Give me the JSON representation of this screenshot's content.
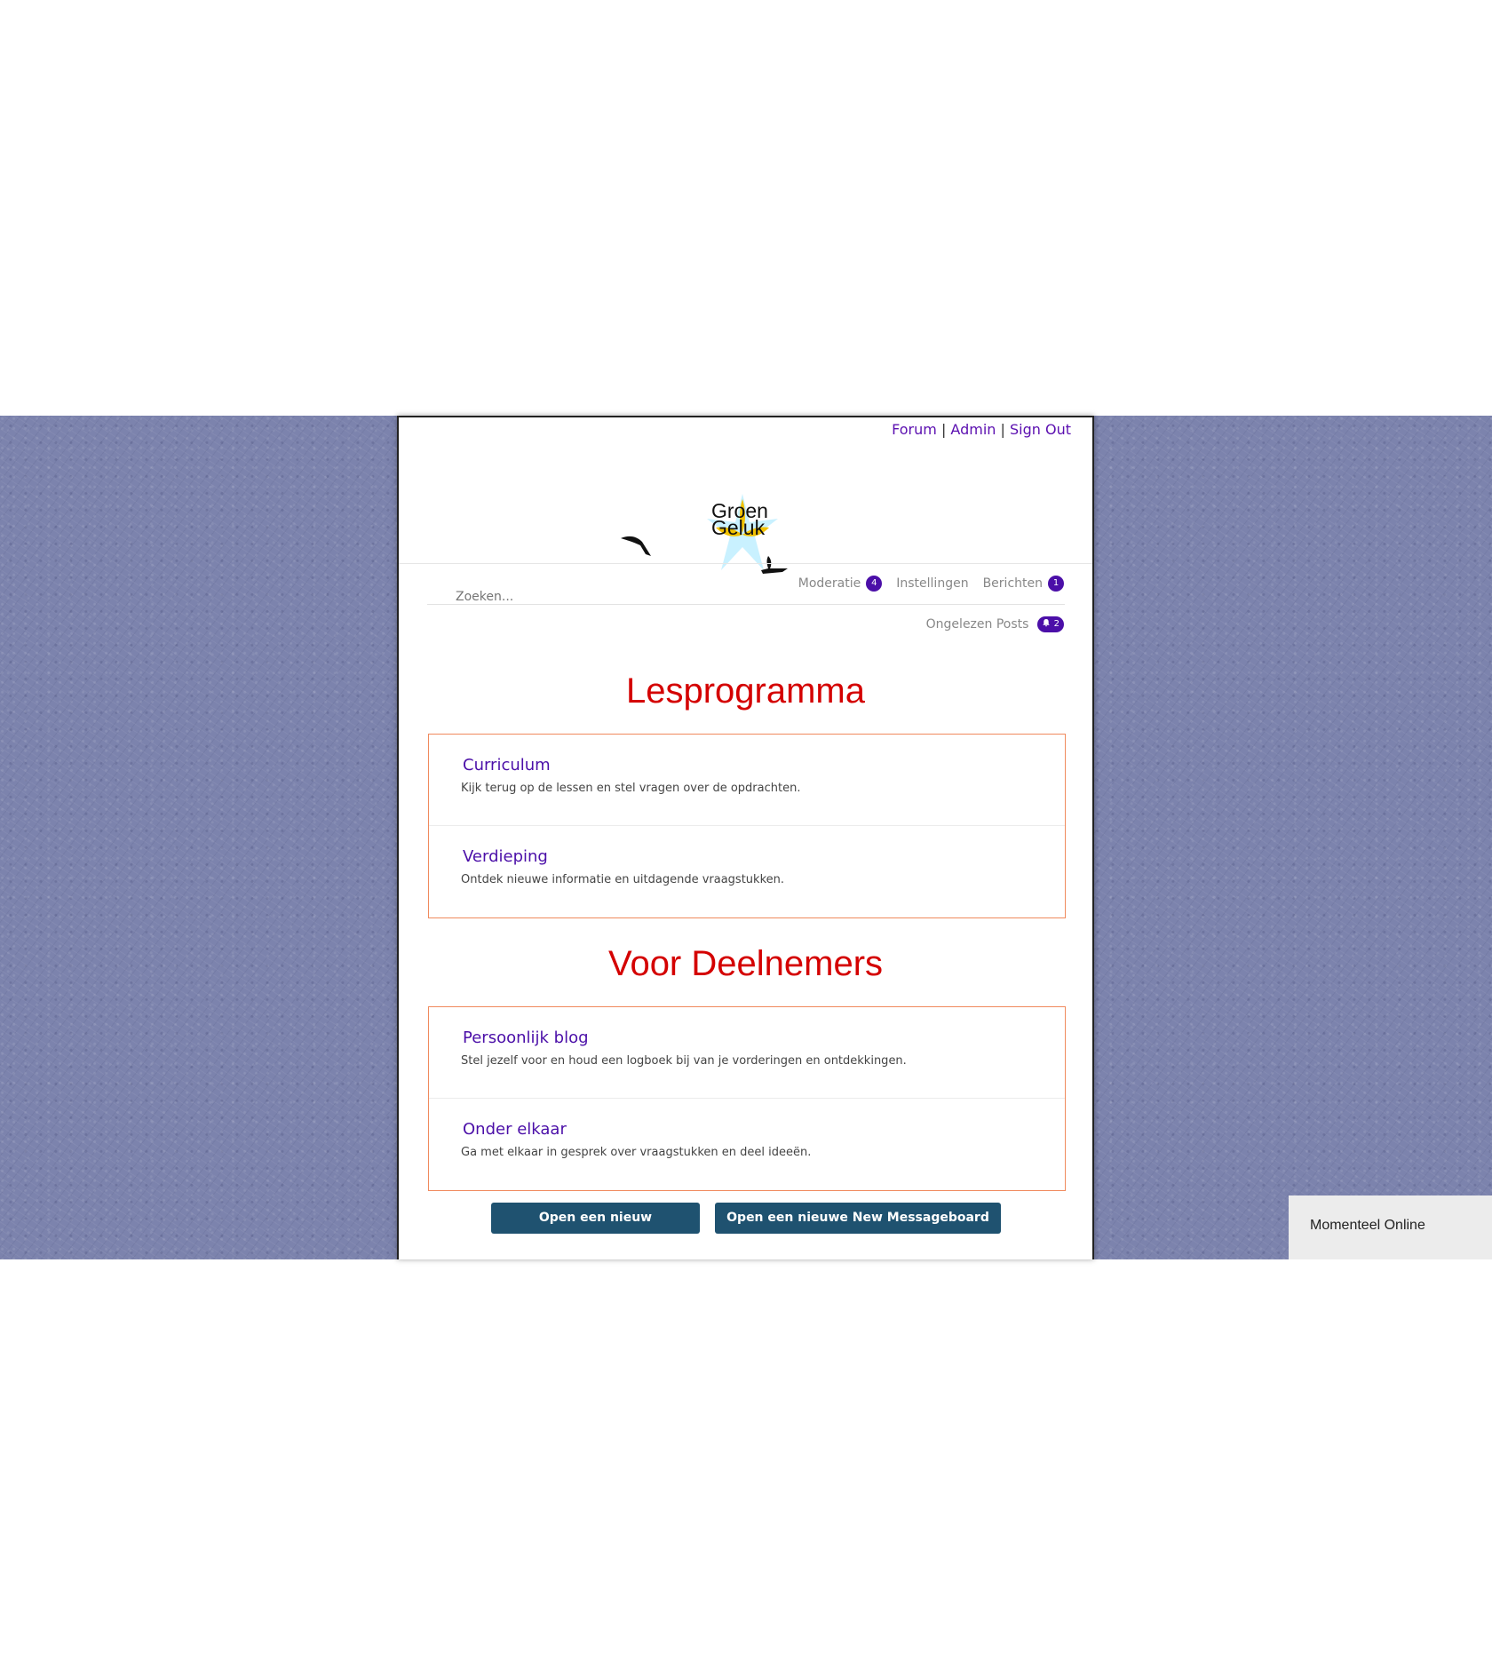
{
  "header": {
    "links": [
      "Forum",
      "Admin",
      "Sign Out"
    ],
    "separator": "|",
    "logo": {
      "line1": "Groen",
      "line2": "Geluk"
    }
  },
  "nav": {
    "moderation_label": "Moderatie",
    "moderation_count": "4",
    "settings_label": "Instellingen",
    "messages_label": "Berichten",
    "messages_count": "1",
    "unread_label": "Ongelezen Posts",
    "unread_count": "2"
  },
  "search": {
    "placeholder": "Zoeken..."
  },
  "sections": [
    {
      "title": "Lesprogramma",
      "forums": [
        {
          "title": "Curriculum",
          "description": "Kijk terug op de lessen en stel vragen over de opdrachten."
        },
        {
          "title": "Verdieping",
          "description": "Ontdek nieuwe informatie en uitdagende vraagstukken."
        }
      ]
    },
    {
      "title": "Voor Deelnemers",
      "forums": [
        {
          "title": "Persoonlijk blog",
          "description": "Stel jezelf voor en houd een logboek bij van je vorderingen en ontdekkingen."
        },
        {
          "title": "Onder elkaar",
          "description": "Ga met elkaar in gesprek over vraagstukken en deel ideeën."
        }
      ]
    }
  ],
  "buttons": {
    "new_board": "Open een nieuw Messageboard",
    "new_group": "Open een nieuwe New Messageboard groep."
  },
  "online_panel": {
    "label": "Momenteel Online"
  },
  "colors": {
    "accent": "#4b0fa8",
    "heading": "#d40000",
    "box_border": "#f08a5d",
    "button": "#1f5270",
    "background": "#7c83ad"
  }
}
